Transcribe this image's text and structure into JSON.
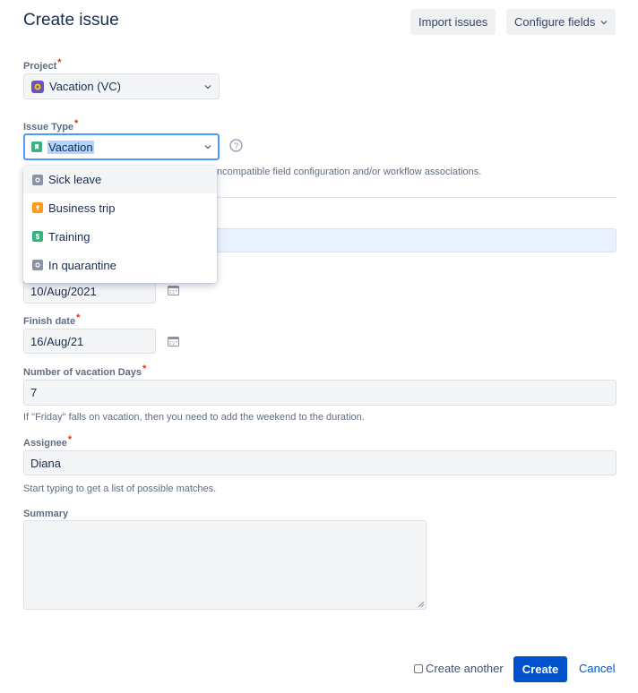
{
  "header": {
    "title": "Create issue",
    "import_label": "Import issues",
    "configure_label": "Configure fields"
  },
  "project": {
    "label": "Project",
    "value": "Vacation (VC)"
  },
  "issue_type": {
    "label": "Issue Type",
    "value": "Vacation",
    "warning": "ncompatible field configuration and/or workflow associations.",
    "options": [
      {
        "label": "Sick leave",
        "color": "#8993a4"
      },
      {
        "label": "Business trip",
        "color": "#ff991f"
      },
      {
        "label": "Training",
        "color": "#36b37e"
      },
      {
        "label": "In quarantine",
        "color": "#8993a4"
      }
    ]
  },
  "start_date": {
    "value": "10/Aug/2021"
  },
  "finish_date": {
    "label": "Finish date",
    "value": "16/Aug/21"
  },
  "vacation_days": {
    "label": "Number of vacation Days",
    "value": "7",
    "help": "If \"Friday\" falls on vacation, then you need to add the weekend to the duration."
  },
  "assignee": {
    "label": "Assignee",
    "value": "Diana",
    "help": "Start typing to get a list of possible matches."
  },
  "summary": {
    "label": "Summary",
    "value": ""
  },
  "footer": {
    "create_another_label": "Create another",
    "create_label": "Create",
    "cancel_label": "Cancel"
  },
  "colors": {
    "accent": "#0052cc",
    "required": "#de350b",
    "focus": "#4c9aff",
    "vacation_icon": "#36b37e"
  },
  "icons": [
    "chevron-down-icon",
    "help-icon",
    "calendar-icon",
    "project-avatar-icon",
    "vacation-type-icon"
  ]
}
